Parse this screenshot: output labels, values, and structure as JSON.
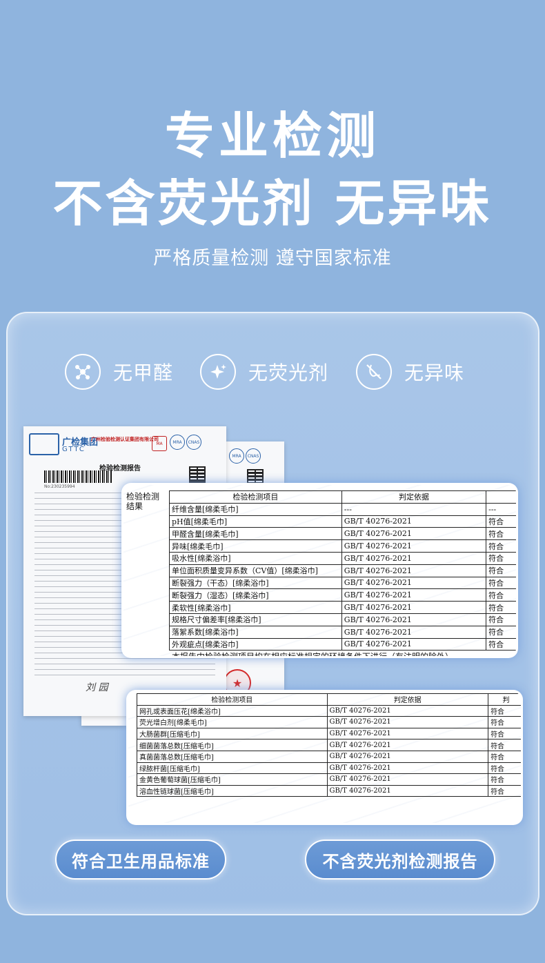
{
  "headline": {
    "line1": "专业检测",
    "line2": "不含荧光剂 无异味",
    "sub": "严格质量检测 遵守国家标准"
  },
  "features": [
    {
      "label": "无甲醛",
      "icon": "molecule-icon"
    },
    {
      "label": "无荧光剂",
      "icon": "sparkle-icon"
    },
    {
      "label": "无异味",
      "icon": "no-smell-icon"
    }
  ],
  "report": {
    "brand": "广检集团",
    "brand_sub": "GTTC",
    "org": "广州检验检测认证集团有限公司",
    "title": "检验检测报告",
    "report_no": "No:230235994",
    "signature": "刘 园",
    "side_header": "检验检测\n结果",
    "table1": {
      "headers": [
        "检验检测项目",
        "判定依据",
        ""
      ],
      "rows": [
        [
          "纤维含量[绵柔毛巾]",
          "---",
          "---"
        ],
        [
          "pH值[绵柔毛巾]",
          "GB/T 40276-2021",
          "符合"
        ],
        [
          "甲醛含量[绵柔毛巾]",
          "GB/T 40276-2021",
          "符合"
        ],
        [
          "异味[绵柔毛巾]",
          "GB/T 40276-2021",
          "符合"
        ],
        [
          "吸水性[绵柔浴巾]",
          "GB/T 40276-2021",
          "符合"
        ],
        [
          "单位面积质量变异系数（CV值）[绵柔浴巾]",
          "GB/T 40276-2021",
          "符合"
        ],
        [
          "断裂强力（干态）[绵柔浴巾]",
          "GB/T 40276-2021",
          "符合"
        ],
        [
          "断裂强力（湿态）[绵柔浴巾]",
          "GB/T 40276-2021",
          "符合"
        ],
        [
          "柔软性[绵柔浴巾]",
          "GB/T 40276-2021",
          "符合"
        ],
        [
          "规格尺寸偏差率[绵柔浴巾]",
          "GB/T 40276-2021",
          "符合"
        ],
        [
          "落絮系数[绵柔浴巾]",
          "GB/T 40276-2021",
          "符合"
        ],
        [
          "外观疵点[绵柔浴巾]",
          "GB/T 40276-2021",
          "符合"
        ]
      ],
      "footnote": "本报告中检验检测项目均在相应标准规定的环境条件下进行（有注明的除外）"
    },
    "table2": {
      "headers": [
        "检验检测项目",
        "判定依据",
        "判"
      ],
      "rows": [
        [
          "网孔或表面压花[绵柔浴巾]",
          "GB/T 40276-2021",
          "符合"
        ],
        [
          "荧光增白剂[绵柔毛巾]",
          "GB/T 40276-2021",
          "符合"
        ],
        [
          "大肠菌群[压缩毛巾]",
          "GB/T 40276-2021",
          "符合"
        ],
        [
          "细菌菌落总数[压缩毛巾]",
          "GB/T 40276-2021",
          "符合"
        ],
        [
          "真菌菌落总数[压缩毛巾]",
          "GB/T 40276-2021",
          "符合"
        ],
        [
          "绿脓杆菌[压缩毛巾]",
          "GB/T 40276-2021",
          "符合"
        ],
        [
          "金黄色葡萄球菌[压缩毛巾]",
          "GB/T 40276-2021",
          "符合"
        ],
        [
          "溶血性链球菌[压缩毛巾]",
          "GB/T 40276-2021",
          "符合"
        ]
      ]
    }
  },
  "pills": {
    "left": "符合卫生用品标准",
    "right": "不含荧光剂检测报告"
  },
  "colors": {
    "background": "#8fb4de",
    "card": "#a9c6e8",
    "pill": "#5a8ccf",
    "brand_blue": "#2b62a8",
    "seal_red": "#d42a2a"
  }
}
